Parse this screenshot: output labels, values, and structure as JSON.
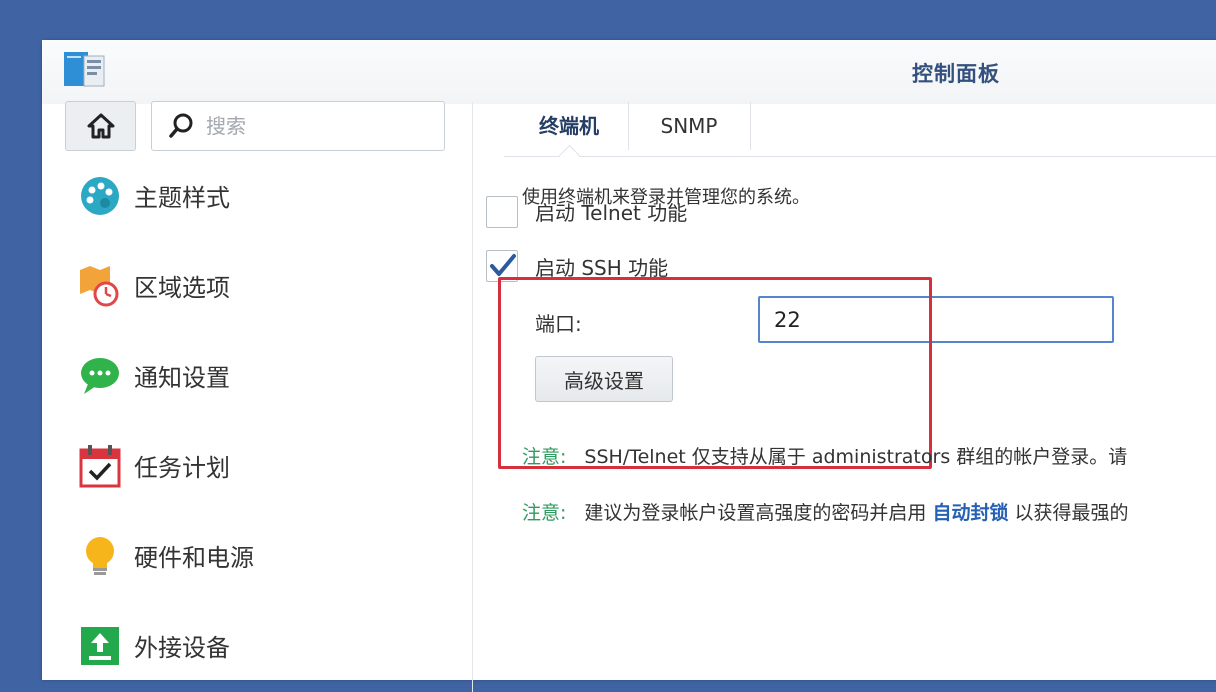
{
  "window": {
    "title": "控制面板"
  },
  "sidebar": {
    "search_placeholder": "搜索",
    "items": [
      {
        "label": "主题样式",
        "icon": "palette-icon"
      },
      {
        "label": "区域选项",
        "icon": "region-clock-icon"
      },
      {
        "label": "通知设置",
        "icon": "chat-bubble-icon"
      },
      {
        "label": "任务计划",
        "icon": "calendar-check-icon"
      },
      {
        "label": "硬件和电源",
        "icon": "lightbulb-icon"
      },
      {
        "label": "外接设备",
        "icon": "external-device-icon"
      }
    ]
  },
  "tabs": [
    {
      "label": "终端机",
      "active": true
    },
    {
      "label": "SNMP",
      "active": false
    }
  ],
  "main": {
    "description": "使用终端机来登录并管理您的系统。",
    "telnet": {
      "label": "启动 Telnet 功能",
      "checked": false
    },
    "ssh": {
      "label": "启动 SSH 功能",
      "checked": true
    },
    "port": {
      "label": "端口:",
      "value": "22"
    },
    "advanced_button": "高级设置",
    "notes": [
      {
        "tag": "注意:",
        "text": "SSH/Telnet 仅支持从属于 administrators 群组的帐户登录。请"
      },
      {
        "tag": "注意:",
        "text_before": "建议为登录帐户设置高强度的密码并启用",
        "link": "自动封锁",
        "text_after": "以获得最强的"
      }
    ]
  },
  "colors": {
    "accent": "#5486c9",
    "highlight": "#d62f3d",
    "note": "#2e9b5e",
    "link": "#2560b4",
    "desktop": "#3f63a3"
  }
}
